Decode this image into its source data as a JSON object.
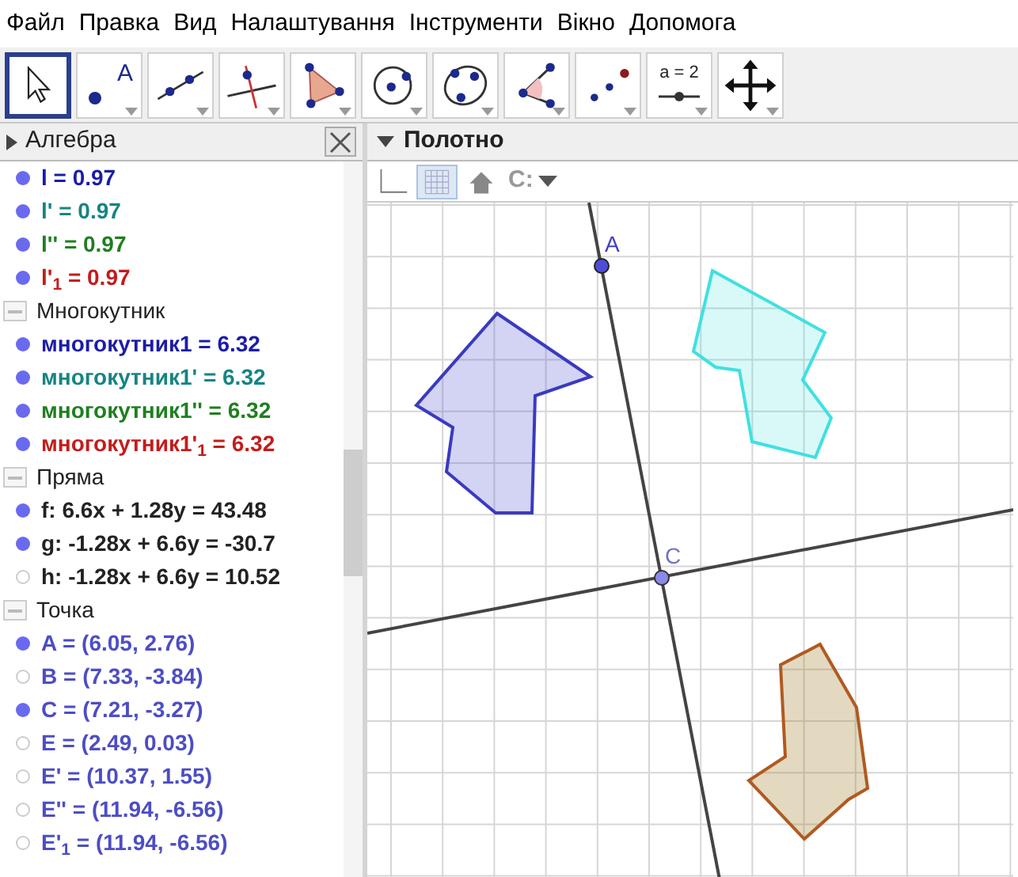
{
  "menu": [
    "Файл",
    "Правка",
    "Вид",
    "Налаштування",
    "Інструменти",
    "Вікно",
    "Допомога"
  ],
  "toolbar": [
    {
      "kind": "move",
      "selected": true
    },
    {
      "kind": "point",
      "label": "A",
      "selected": false
    },
    {
      "kind": "line",
      "selected": false
    },
    {
      "kind": "perpendicular",
      "selected": false
    },
    {
      "kind": "polygon",
      "selected": false
    },
    {
      "kind": "circle",
      "selected": false
    },
    {
      "kind": "conic",
      "selected": false
    },
    {
      "kind": "angle",
      "selected": false
    },
    {
      "kind": "reflect",
      "selected": false
    },
    {
      "kind": "slider",
      "label": "a = 2",
      "selected": false
    },
    {
      "kind": "pan",
      "selected": false
    }
  ],
  "algebra": {
    "title": "Алгебра",
    "groups": [
      {
        "items": [
          {
            "text": "l = 0.97",
            "color": "#1c1ca8",
            "visible": true
          },
          {
            "text": "l' = 0.97",
            "color": "#168484",
            "visible": true
          },
          {
            "text": "l'' = 0.97",
            "color": "#1f7f1f",
            "visible": true
          },
          {
            "text": "l'$_{1}$ = 0.97",
            "color": "#c41c1c",
            "visible": true
          }
        ]
      },
      {
        "heading": "Многокутник",
        "items": [
          {
            "text": "многокутник1 = 6.32",
            "color": "#1c1ca8",
            "visible": true
          },
          {
            "text": "многокутник1' = 6.32",
            "color": "#168484",
            "visible": true
          },
          {
            "text": "многокутник1'' = 6.32",
            "color": "#1f7f1f",
            "visible": true
          },
          {
            "text": "многокутник1'$_{1}$ = 6.32",
            "color": "#c41c1c",
            "visible": true
          }
        ]
      },
      {
        "heading": "Пряма",
        "items": [
          {
            "text": "f: 6.6x + 1.28y = 43.48",
            "color": "#222222",
            "visible": true
          },
          {
            "text": "g: -1.28x + 6.6y = -30.7",
            "color": "#222222",
            "visible": true
          },
          {
            "text": "h: -1.28x + 6.6y = 10.52",
            "color": "#222222",
            "visible": false
          }
        ]
      },
      {
        "heading": "Точка",
        "items": [
          {
            "text": "A = (6.05, 2.76)",
            "color": "#4d4dc4",
            "visible": true
          },
          {
            "text": "B = (7.33, -3.84)",
            "color": "#4d4dc4",
            "visible": false
          },
          {
            "text": "C = (7.21, -3.27)",
            "color": "#4d4dc4",
            "visible": true
          },
          {
            "text": "E = (2.49, 0.03)",
            "color": "#4d4dc4",
            "visible": false
          },
          {
            "text": "E' = (10.37, 1.55)",
            "color": "#4d4dc4",
            "visible": false
          },
          {
            "text": "E'' = (11.94, -6.56)",
            "color": "#4d4dc4",
            "visible": false
          },
          {
            "text": "E'$_{1}$ = (11.94, -6.56)",
            "color": "#4d4dc4",
            "visible": false
          }
        ]
      }
    ]
  },
  "canvas": {
    "title": "Полотно",
    "style_bar": [
      {
        "kind": "axes",
        "selected": false
      },
      {
        "kind": "grid",
        "selected": true
      },
      {
        "kind": "home",
        "selected": false
      },
      {
        "kind": "capture",
        "label": "C:",
        "selected": false
      }
    ],
    "points": [
      {
        "label": "A"
      },
      {
        "label": "C"
      }
    ]
  }
}
